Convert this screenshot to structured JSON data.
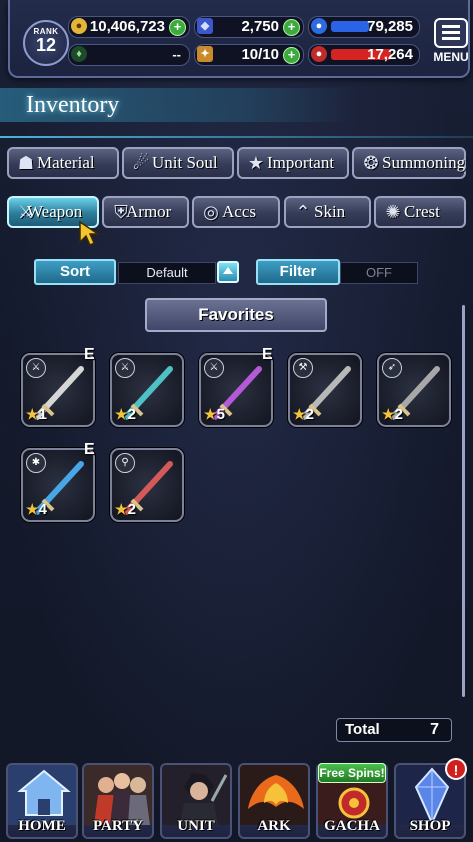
{
  "topbar": {
    "rank_label": "RANK",
    "rank_value": "12",
    "gil": "10,406,723",
    "gems": "2,750",
    "exp": "79,285",
    "exp_bar_fraction": 0.45,
    "rank_status": "--",
    "stamina": "10/10",
    "hp_stat": "17,264",
    "hp_bar_fraction": 0.72,
    "menu_label": "MENU"
  },
  "header": {
    "title": "Inventory"
  },
  "tabs_row1": [
    {
      "label": "Material",
      "icon": "bag-icon"
    },
    {
      "label": "Unit Soul",
      "icon": "soul-icon"
    },
    {
      "label": "Important",
      "icon": "star-icon"
    },
    {
      "label": "Summoning",
      "icon": "summon-icon"
    }
  ],
  "tabs_row2": [
    {
      "label": "Weapon",
      "icon": "sword-icon",
      "active": true
    },
    {
      "label": "Armor",
      "icon": "armor-icon"
    },
    {
      "label": "Accs",
      "icon": "ring-icon"
    },
    {
      "label": "Skin",
      "icon": "hanger-icon"
    },
    {
      "label": "Crest",
      "icon": "crest-icon"
    }
  ],
  "controls": {
    "sort_label": "Sort",
    "sort_value": "Default",
    "filter_label": "Filter",
    "filter_value": "OFF",
    "favorites_label": "Favorites"
  },
  "items": [
    {
      "stars": "1",
      "equipped": "E",
      "type": "sword-icon",
      "color": "#d6d6d6"
    },
    {
      "stars": "2",
      "equipped": "",
      "type": "sword-icon",
      "color": "#4fc0c4"
    },
    {
      "stars": "5",
      "equipped": "E",
      "type": "sword-icon",
      "color": "#b55ad6"
    },
    {
      "stars": "2",
      "equipped": "",
      "type": "axe-icon",
      "color": "#b8b8b8"
    },
    {
      "stars": "2",
      "equipped": "",
      "type": "bow-icon",
      "color": "#a8a8a8"
    },
    {
      "stars": "4",
      "equipped": "E",
      "type": "gun-icon",
      "color": "#49a6e6"
    },
    {
      "stars": "2",
      "equipped": "",
      "type": "staff-icon",
      "color": "#d45a5a"
    }
  ],
  "total": {
    "label": "Total",
    "value": "7"
  },
  "nav": [
    {
      "label": "HOME"
    },
    {
      "label": "PARTY"
    },
    {
      "label": "UNIT"
    },
    {
      "label": "ARK"
    },
    {
      "label": "GACHA"
    },
    {
      "label": "SHOP"
    }
  ],
  "badges": {
    "free_spins": "Free Spins!",
    "shop_alert": "!"
  }
}
